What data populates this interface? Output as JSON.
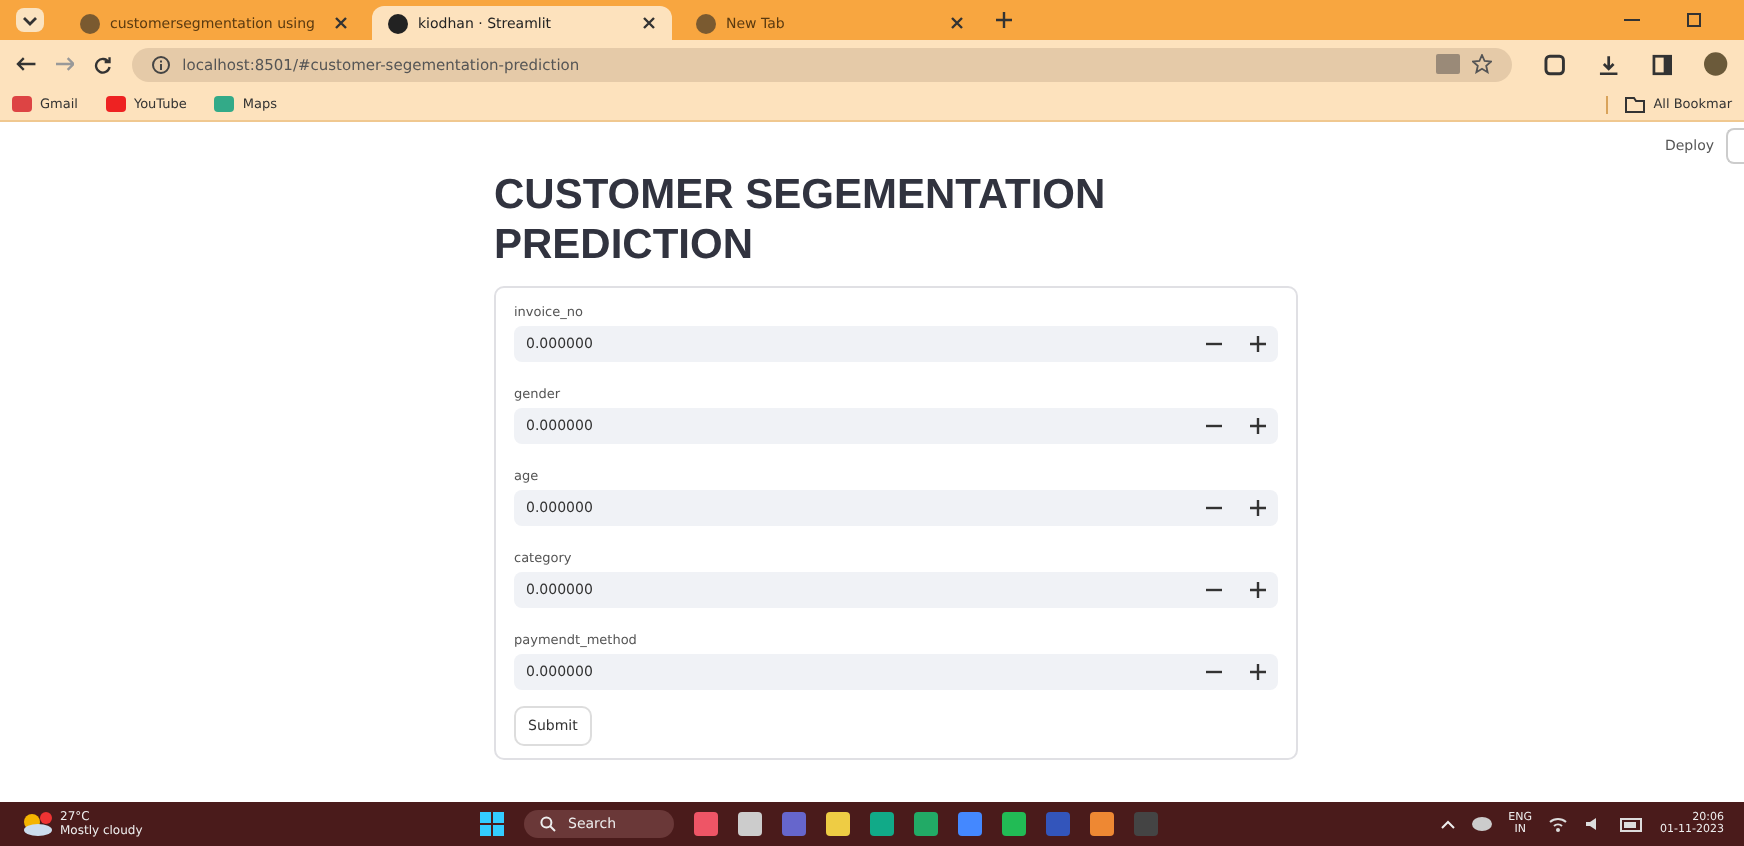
{
  "tabs": [
    {
      "title": "customersegmentation using",
      "selected": false
    },
    {
      "title": "kiodhan · Streamlit",
      "selected": true
    },
    {
      "title": "New Tab",
      "selected": false
    }
  ],
  "address": "localhost:8501/#customer-segementation-prediction",
  "bookmarks": [
    "Gmail",
    "YouTube",
    "Maps"
  ],
  "all_bookmarks": "All Bookmar",
  "deploy": "Deploy",
  "heading": "CUSTOMER SEGEMENTATION PREDICTION",
  "fields": [
    {
      "label": "invoice_no",
      "value": "0.000000"
    },
    {
      "label": "gender",
      "value": "0.000000"
    },
    {
      "label": "age",
      "value": "0.000000"
    },
    {
      "label": "category",
      "value": "0.000000"
    },
    {
      "label": "paymendt_method",
      "value": "0.000000"
    }
  ],
  "submit": "Submit",
  "taskbar": {
    "temperature": "27°C",
    "weather": "Mostly cloudy",
    "search": "Search",
    "lang": "ENG",
    "region": "IN",
    "time": "20:06",
    "date": "01-11-2023"
  }
}
